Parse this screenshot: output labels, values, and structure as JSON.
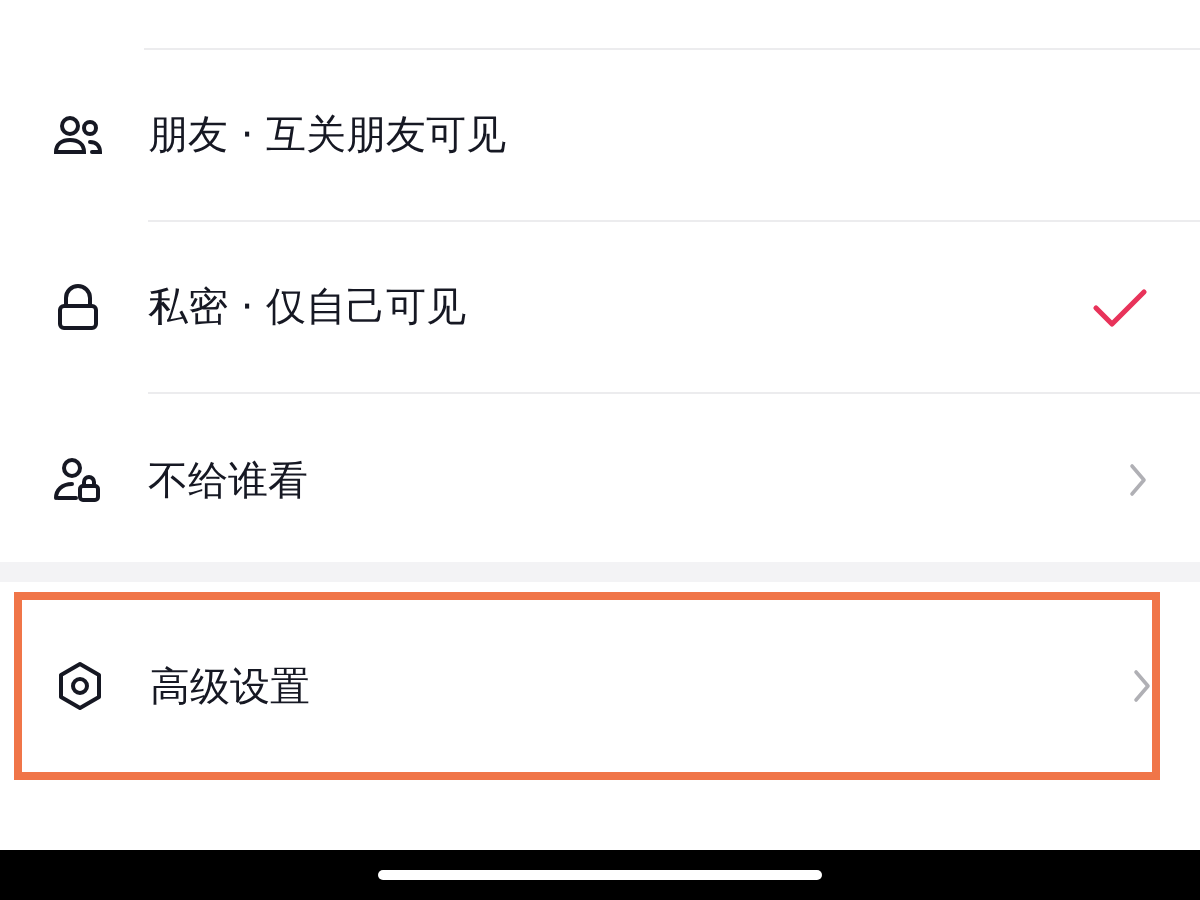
{
  "options": [
    {
      "kind": "option",
      "label": "朋友 · 互关朋友可见",
      "selected": false
    },
    {
      "kind": "option",
      "label": "私密 · 仅自己可见",
      "selected": true
    },
    {
      "kind": "link",
      "label": "不给谁看"
    }
  ],
  "advanced": {
    "kind": "link",
    "label": "高级设置",
    "highlighted": true
  }
}
